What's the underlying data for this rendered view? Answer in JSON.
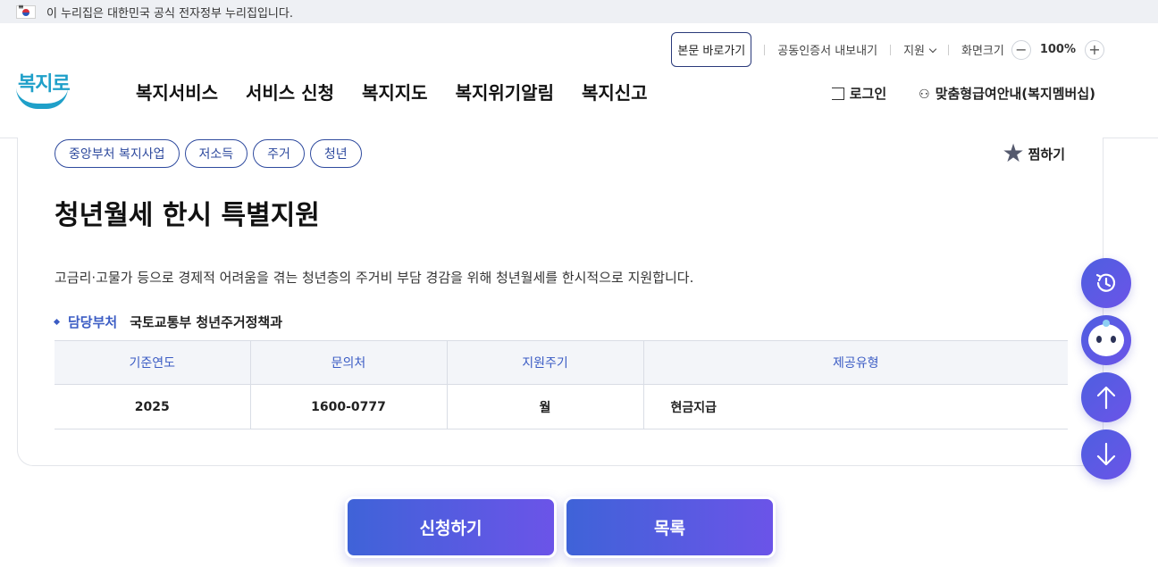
{
  "gov_banner": {
    "text": "이 누리집은 대한민국 공식 전자정부 누리집입니다."
  },
  "utility": {
    "skip_label": "본문 바로가기",
    "cert_label": "공동인증서 내보내기",
    "support_label": "지원",
    "zoom_label": "화면크기",
    "zoom_value": "100%",
    "zoom_out": "−",
    "zoom_in": "+"
  },
  "logo": {
    "text": "복지로"
  },
  "gnb": [
    "복지서비스",
    "서비스 신청",
    "복지지도",
    "복지위기알림",
    "복지신고"
  ],
  "member": {
    "login_label": "로그인",
    "membership_label": "맞춤형급여안내(복지멤버십)"
  },
  "service": {
    "tags": [
      "중앙부처 복지사업",
      "저소득",
      "주거",
      "청년"
    ],
    "wish_label": "찜하기",
    "title": "청년월세 한시 특별지원",
    "description": "고금리·고물가 등으로 경제적 어려움을 겪는 청년층의 주거비 부담 경감을 위해 청년월세를 한시적으로 지원합니다.",
    "dept_label": "담당부처",
    "dept_value": "국토교통부 청년주거정책과",
    "table": {
      "headers": [
        "기준연도",
        "문의처",
        "지원주기",
        "제공유형"
      ],
      "row": [
        "2025",
        "1600-0777",
        "월",
        "현금지급"
      ]
    }
  },
  "actions": {
    "apply_label": "신청하기",
    "list_label": "목록"
  },
  "icons": {
    "history": "history-icon",
    "chatbot": "chatbot-icon",
    "up": "arrow-up-icon",
    "down": "arrow-down-icon"
  },
  "colors": {
    "primary": "#3b5cc4",
    "accent_start": "#3f63d8",
    "accent_end": "#6b54e8"
  }
}
